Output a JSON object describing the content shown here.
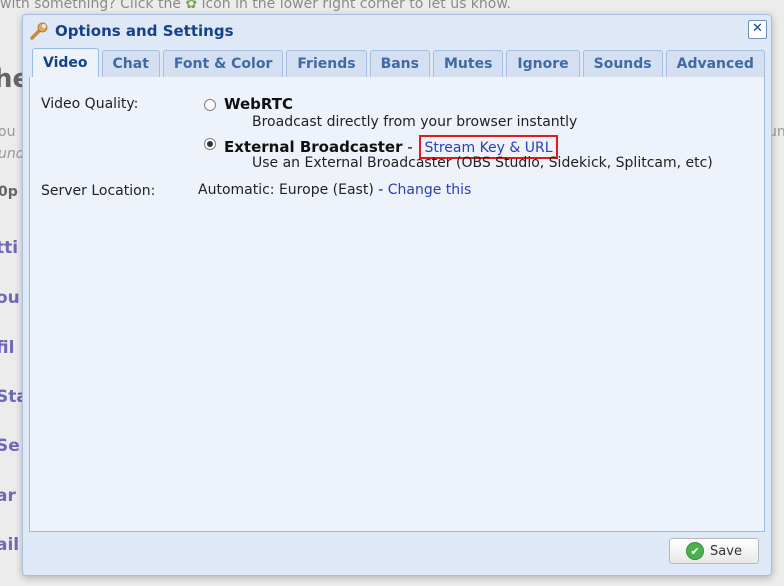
{
  "background": {
    "top_text_before": "with something? Click the",
    "top_text_after": "icon in the lower right corner to let us know.",
    "heading_fragment": "he",
    "small_fragments": [
      "ou",
      "und",
      "0p"
    ],
    "right_fragment": "un",
    "left_link_fragments": [
      "tti",
      "ou",
      "fil",
      "Sta",
      "Se",
      "ar",
      "ail"
    ]
  },
  "dialog": {
    "title": "Options and Settings",
    "close_label": "✕",
    "tabs": [
      {
        "label": "Video",
        "active": true
      },
      {
        "label": "Chat",
        "active": false
      },
      {
        "label": "Font & Color",
        "active": false
      },
      {
        "label": "Friends",
        "active": false
      },
      {
        "label": "Bans",
        "active": false
      },
      {
        "label": "Mutes",
        "active": false
      },
      {
        "label": "Ignore",
        "active": false
      },
      {
        "label": "Sounds",
        "active": false
      },
      {
        "label": "Advanced",
        "active": false
      }
    ],
    "video": {
      "quality_label": "Video Quality:",
      "webrtc": {
        "title": "WebRTC",
        "desc": "Broadcast directly from your browser instantly",
        "checked": false
      },
      "external": {
        "title": "External Broadcaster",
        "separator": " - ",
        "link": "Stream Key & URL",
        "desc": "Use an External Broadcaster (OBS Studio, Sidekick, Splitcam, etc)",
        "checked": true
      },
      "server_label": "Server Location:",
      "server_value": "Automatic: Europe (East) - ",
      "server_link": "Change this"
    },
    "save_label": "Save",
    "colors": {
      "title": "#15428b",
      "link": "#2a3fb8",
      "highlight": "#e01b1b"
    }
  }
}
